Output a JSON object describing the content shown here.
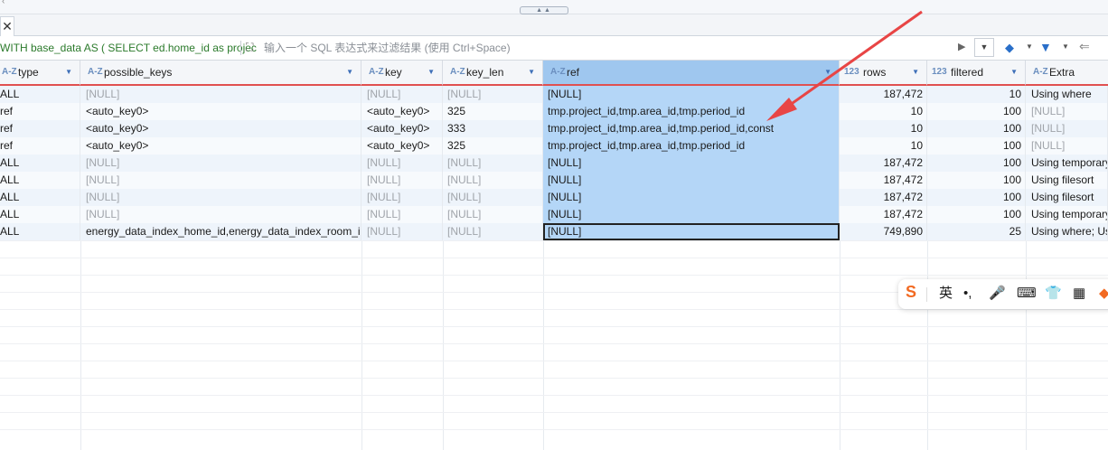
{
  "topbar": {
    "caret": "‹",
    "splitter": "▲▲"
  },
  "tab": {
    "close": "✕"
  },
  "filter": {
    "query": "WITH base_data AS ( SELECT ed.home_id as projec",
    "placeholder": "输入一个 SQL 表达式来过滤结果 (使用 Ctrl+Space)",
    "expand_icon": "⛶",
    "run_icon": "▶",
    "history_icon": "▼",
    "eraser_icon": "◆",
    "funnel_icon": "▼",
    "back_icon": "⇐"
  },
  "columns": [
    {
      "type": "A-Z",
      "name": "type"
    },
    {
      "type": "A-Z",
      "name": "possible_keys"
    },
    {
      "type": "A-Z",
      "name": "key"
    },
    {
      "type": "A-Z",
      "name": "key_len"
    },
    {
      "type": "A-Z",
      "name": "ref"
    },
    {
      "type": "123",
      "name": "rows"
    },
    {
      "type": "123",
      "name": "filtered"
    },
    {
      "type": "A-Z",
      "name": "Extra"
    }
  ],
  "rows": [
    [
      "ALL",
      "[NULL]",
      "[NULL]",
      "[NULL]",
      "[NULL]",
      "187,472",
      "10",
      "Using where"
    ],
    [
      "ref",
      "<auto_key0>",
      "<auto_key0>",
      "325",
      "tmp.project_id,tmp.area_id,tmp.period_id",
      "10",
      "100",
      "[NULL]"
    ],
    [
      "ref",
      "<auto_key0>",
      "<auto_key0>",
      "333",
      "tmp.project_id,tmp.area_id,tmp.period_id,const",
      "10",
      "100",
      "[NULL]"
    ],
    [
      "ref",
      "<auto_key0>",
      "<auto_key0>",
      "325",
      "tmp.project_id,tmp.area_id,tmp.period_id",
      "10",
      "100",
      "[NULL]"
    ],
    [
      "ALL",
      "[NULL]",
      "[NULL]",
      "[NULL]",
      "[NULL]",
      "187,472",
      "100",
      "Using temporary"
    ],
    [
      "ALL",
      "[NULL]",
      "[NULL]",
      "[NULL]",
      "[NULL]",
      "187,472",
      "100",
      "Using filesort"
    ],
    [
      "ALL",
      "[NULL]",
      "[NULL]",
      "[NULL]",
      "[NULL]",
      "187,472",
      "100",
      "Using filesort"
    ],
    [
      "ALL",
      "[NULL]",
      "[NULL]",
      "[NULL]",
      "[NULL]",
      "187,472",
      "100",
      "Using temporary"
    ],
    [
      "ALL",
      "energy_data_index_home_id,energy_data_index_room_id",
      "[NULL]",
      "[NULL]",
      "[NULL]",
      "749,890",
      "25",
      "Using where; Us"
    ]
  ],
  "ime_toolbar": {
    "logo": "S",
    "lang": "英",
    "punct": "•,",
    "mic": "🎤",
    "keyboard": "⌨",
    "skin": "👕",
    "grid": "▦",
    "more": "◆"
  },
  "colors": {
    "accent": "#e84545",
    "selected_column": "#b4d6f7",
    "query_text": "#2b7a2b"
  }
}
